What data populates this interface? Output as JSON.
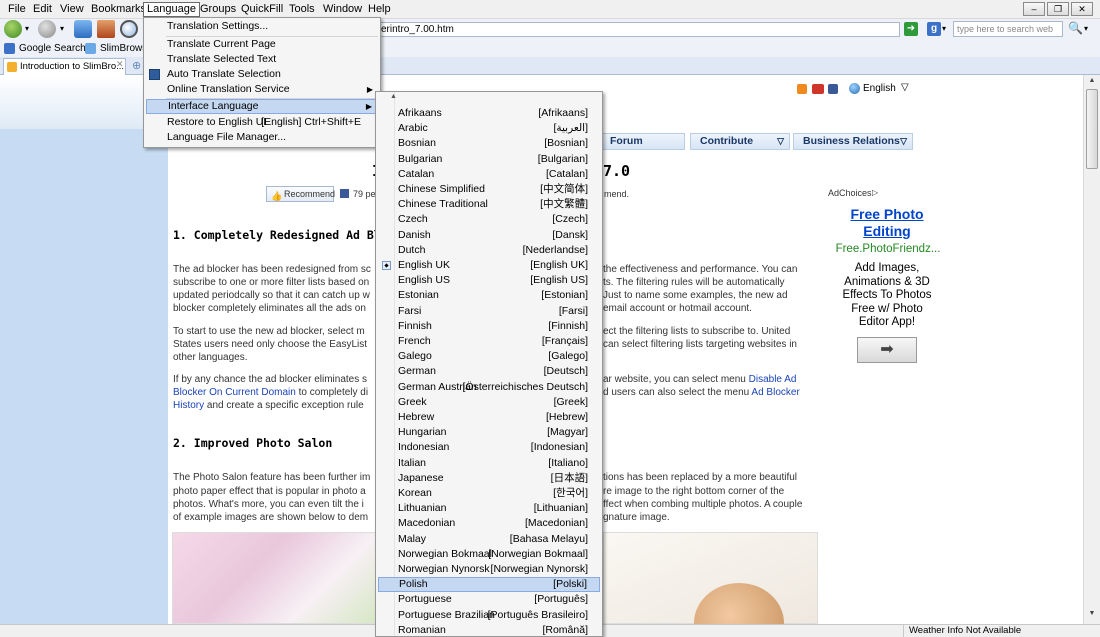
{
  "menubar": {
    "items": [
      "File",
      "Edit",
      "View",
      "Bookmarks",
      "Language",
      "Groups",
      "QuickFill",
      "Tools",
      "Window",
      "Help"
    ]
  },
  "toolbar": {
    "url_visible": "erintro_7.00.htm",
    "search_placeholder": "type here to search web"
  },
  "bookmarks": {
    "items": [
      "Google Search",
      "SlimBrows"
    ]
  },
  "tabs": {
    "active_title": "Introduction to SlimBro..."
  },
  "page": {
    "language_selector": "English",
    "nav": [
      "Forum",
      "Contribute",
      "Business Relations"
    ],
    "title_fragment": "I",
    "title_version": "7.0",
    "recommend_label": "Recommend",
    "likes_prefix": "79 pe",
    "likes_suffix": "mend.",
    "section1_heading": "1. Completely Redesigned Ad Blocker",
    "p1a": "The ad blocker has been redesigned from sc",
    "p1b": "subscribe to one or more filter lists based on",
    "p1c": "updated periodcally so that it can catch up w",
    "p1d": "blocker completely eliminates all the ads on",
    "p1a_r": "the effectiveness and performance. You can",
    "p1b_r": "ts. The filtering rules will be automatically",
    "p1c_r": "Just to name some examples, the new ad",
    "p1d_r": "email account or hotmail account.",
    "p2a": "To start to use the new ad blocker, select m",
    "p2b": "States users need only choose the EasyList",
    "p2c": "other languages.",
    "p2a_r": "ect the filtering lists to subscribe to. United",
    "p2b_r": "can select filtering lists targeting websites in",
    "p3a": "If by any chance the ad blocker eliminates s",
    "p3b": "Blocker On Current Domain",
    "p3b2": " to completely di",
    "p3c": "History",
    "p3c2": " and create a specific exception rule",
    "p3a_r": "ar website, you can select menu ",
    "p3a_link": "Disable Ad",
    "p3b_r": "d users can also select the menu ",
    "p3b_link": "Ad Blocker",
    "section2_heading": "2. Improved Photo Salon",
    "p4a": "The Photo Salon feature has been further im",
    "p4b": "photo paper effect that is popular in photo a",
    "p4c": "photos. What's more, you can even tilt the i",
    "p4d": "of example images are shown below to dem",
    "p4a_r": "tions has been replaced by a more beautiful",
    "p4b_r": "re image to the right bottom corner of the",
    "p4c_r": "ffect when combing multiple photos. A couple",
    "p4d_r": "gnature image."
  },
  "ad": {
    "adchoices": "AdChoices",
    "headline1": "Free Photo",
    "headline2": "Editing",
    "domain": "Free.PhotoFriendz...",
    "body": [
      "Add Images,",
      "Animations & 3D",
      "Effects To Photos",
      "Free w/ Photo",
      "Editor App!"
    ]
  },
  "status": {
    "weather": "Weather Info Not Available"
  },
  "language_menu": {
    "items": [
      {
        "label": "Translation Settings...",
        "shortcut": ""
      },
      {
        "label": "Translate Current Page",
        "shortcut": ""
      },
      {
        "label": "Translate Selected Text",
        "shortcut": ""
      },
      {
        "label": "Auto Translate Selection",
        "shortcut": ""
      },
      {
        "label": "Online Translation Service",
        "shortcut": ""
      },
      {
        "label": "Interface Language",
        "shortcut": ""
      },
      {
        "label": "Restore to English UI",
        "shortcut": "[English] Ctrl+Shift+E"
      },
      {
        "label": "Language File Manager...",
        "shortcut": ""
      }
    ]
  },
  "interface_languages": [
    {
      "name": "Afrikaans",
      "native": "[Afrikaans]"
    },
    {
      "name": "Arabic",
      "native": "[العربية]"
    },
    {
      "name": "Bosnian",
      "native": "[Bosnian]"
    },
    {
      "name": "Bulgarian",
      "native": "[Bulgarian]"
    },
    {
      "name": "Catalan",
      "native": "[Catalan]"
    },
    {
      "name": "Chinese Simplified",
      "native": "[中文简体]"
    },
    {
      "name": "Chinese Traditional",
      "native": "[中文繁體]"
    },
    {
      "name": "Czech",
      "native": "[Czech]"
    },
    {
      "name": "Danish",
      "native": "[Dansk]"
    },
    {
      "name": "Dutch",
      "native": "[Nederlandse]"
    },
    {
      "name": "English UK",
      "native": "[English UK]"
    },
    {
      "name": "English US",
      "native": "[English US]"
    },
    {
      "name": "Estonian",
      "native": "[Estonian]"
    },
    {
      "name": "Farsi",
      "native": "[Farsi]"
    },
    {
      "name": "Finnish",
      "native": "[Finnish]"
    },
    {
      "name": "French",
      "native": "[Français]"
    },
    {
      "name": "Galego",
      "native": "[Galego]"
    },
    {
      "name": "German",
      "native": "[Deutsch]"
    },
    {
      "name": "German Austrian",
      "native": "[Österreichisches Deutsch]"
    },
    {
      "name": "Greek",
      "native": "[Greek]"
    },
    {
      "name": "Hebrew",
      "native": "[Hebrew]"
    },
    {
      "name": "Hungarian",
      "native": "[Magyar]"
    },
    {
      "name": "Indonesian",
      "native": "[Indonesian]"
    },
    {
      "name": "Italian",
      "native": "[Italiano]"
    },
    {
      "name": "Japanese",
      "native": "[日本語]"
    },
    {
      "name": "Korean",
      "native": "[한국어]"
    },
    {
      "name": "Lithuanian",
      "native": "[Lithuanian]"
    },
    {
      "name": "Macedonian",
      "native": "[Macedonian]"
    },
    {
      "name": "Malay",
      "native": "[Bahasa Melayu]"
    },
    {
      "name": "Norwegian Bokmaal",
      "native": "[Norwegian Bokmaal]"
    },
    {
      "name": "Norwegian Nynorsk",
      "native": "[Norwegian Nynorsk]"
    },
    {
      "name": "Polish",
      "native": "[Polski]"
    },
    {
      "name": "Portuguese",
      "native": "[Português]"
    },
    {
      "name": "Portuguese Brazilian",
      "native": "[Português Brasileiro]"
    },
    {
      "name": "Romanian",
      "native": "[Română]"
    }
  ],
  "state": {
    "checked_language": "English UK",
    "highlighted_language": "Polish",
    "highlighted_menu_item": "Interface Language"
  },
  "colors": {
    "menu_highlight": "#c5d8f2",
    "link": "#1a44b8",
    "ad_link": "#0044cc",
    "ad_domain": "#228822"
  }
}
